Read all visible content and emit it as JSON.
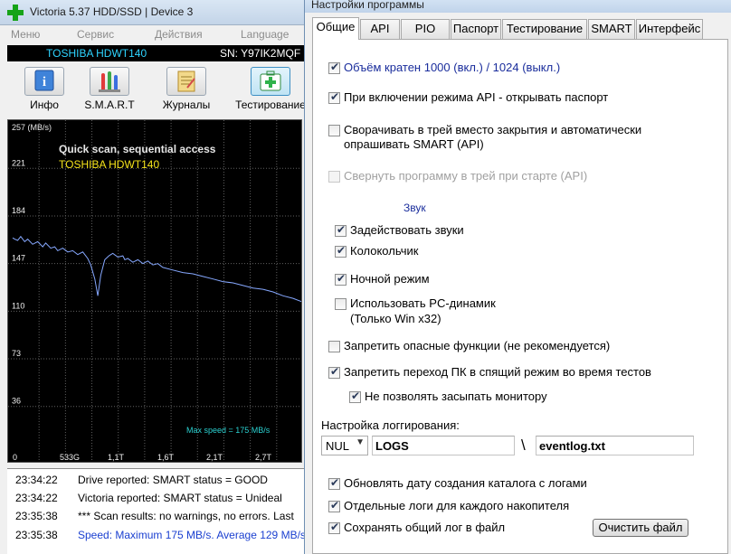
{
  "main_window": {
    "title": "Victoria 5.37 HDD/SSD | Device 3",
    "menu": [
      "Меню",
      "Сервис",
      "Действия",
      "Language"
    ],
    "device": {
      "model": "TOSHIBA HDWT140",
      "serial": "SN: Y97IK2MQF"
    },
    "toolbar": [
      {
        "label": "Инфо",
        "icon": "info-icon"
      },
      {
        "label": "S.M.A.R.T",
        "icon": "smart-icon"
      },
      {
        "label": "Журналы",
        "icon": "journal-icon"
      },
      {
        "label": "Тестирование",
        "icon": "medkit-icon"
      }
    ],
    "log": [
      {
        "time": "23:34:22",
        "message": "Drive reported: SMART status = GOOD",
        "color": "#000000"
      },
      {
        "time": "23:34:22",
        "message": "Victoria reported: SMART status = Unideal",
        "color": "#000000"
      },
      {
        "time": "23:35:38",
        "message": "*** Scan results: no warnings, no errors. Last",
        "color": "#000000"
      },
      {
        "time": "23:35:38",
        "message": "Speed: Maximum 175 MB/s. Average 129 MB/s",
        "color": "#1a3fd0"
      }
    ]
  },
  "chart_data": {
    "type": "line",
    "title": "Quick scan, sequential access",
    "subtitle": "TOSHIBA HDWT140",
    "ylabel": "257 (MB/s)",
    "y_ticks": [
      "221",
      "184",
      "147",
      "110",
      "73",
      "36"
    ],
    "x_ticks": [
      "0",
      "533G",
      "1,1T",
      "1,6T",
      "2,1T",
      "2,7T"
    ],
    "annotation": "Max speed = 175 MB/s",
    "ylim": [
      0,
      257
    ],
    "grid": true,
    "series": [
      {
        "color": "#86a8ff",
        "x": [
          0,
          0.02,
          0.05,
          0.08,
          0.12,
          0.15,
          0.2,
          0.25,
          0.3,
          0.33,
          0.38,
          0.42,
          0.45,
          0.5,
          0.55,
          0.6,
          0.65,
          0.7,
          0.75,
          0.78,
          0.82,
          0.85,
          0.88,
          0.92,
          0.96,
          0.98,
          1.0,
          1.05,
          1.1,
          1.12,
          1.15,
          1.2,
          1.25,
          1.3,
          1.35,
          1.4,
          1.45,
          1.5,
          1.6,
          1.7,
          1.8,
          1.9,
          2.0,
          2.1,
          2.2,
          2.3,
          2.4,
          2.5,
          2.6,
          2.7,
          2.8,
          2.9
        ],
        "y": [
          167,
          166,
          165,
          168,
          164,
          166,
          162,
          164,
          160,
          163,
          159,
          160,
          157,
          159,
          156,
          157,
          154,
          156,
          151,
          146,
          135,
          122,
          138,
          150,
          153,
          154,
          155,
          152,
          153,
          150,
          151,
          148,
          150,
          147,
          149,
          146,
          147,
          144,
          142,
          140,
          139,
          137,
          135,
          133,
          132,
          130,
          128,
          127,
          125,
          122,
          120,
          117
        ]
      }
    ]
  },
  "dialog": {
    "title": "Настройки программы",
    "tabs": [
      "Общие",
      "API",
      "PIO",
      "Паспорт",
      "Тестирование",
      "SMART",
      "Интерфейс"
    ],
    "active_tab": "Общие",
    "options": {
      "volume_1000": {
        "label": "Объём кратен 1000 (вкл.) / 1024 (выкл.)",
        "checked": true
      },
      "api_open_passport": {
        "label": "При включении режима API - открывать паспорт",
        "checked": true
      },
      "tray_line1": "Сворачивать в трей вместо закрытия и автоматически",
      "tray_line2": "опрашивать SMART (API)",
      "tray_on_start": {
        "label": "Свернуть программу в трей при старте (API)",
        "checked": false
      },
      "sound_header": "Звук",
      "use_sounds": {
        "label": "Задействовать звуки",
        "checked": true
      },
      "bell": {
        "label": "Колокольчик",
        "checked": true
      },
      "night_mode": {
        "label": "Ночной режим",
        "checked": true
      },
      "pc_speaker_line1": "Использовать PC-динамик",
      "pc_speaker_line2": "(Только Win x32)",
      "forbid_dangerous": {
        "label": "Запретить опасные функции (не рекомендуется)",
        "checked": false
      },
      "forbid_sleep": {
        "label": "Запретить переход ПК в спящий режим во время тестов",
        "checked": true
      },
      "no_monitor_sleep": {
        "label": "Не позволять засыпать монитору",
        "checked": true
      }
    },
    "logging": {
      "header": "Настройка логгирования:",
      "device": "NUL",
      "folder": "LOGS",
      "separator": "\\",
      "file": "eventlog.txt"
    },
    "bottom_options": {
      "update_date": {
        "label": "Обновлять дату создания каталога с логами",
        "checked": true
      },
      "separate_logs": {
        "label": "Отдельные логи для каждого накопителя",
        "checked": true
      },
      "save_common": {
        "label": "Сохранять общий лог в файл",
        "checked": true
      }
    },
    "clear_button": "Очистить файл"
  }
}
